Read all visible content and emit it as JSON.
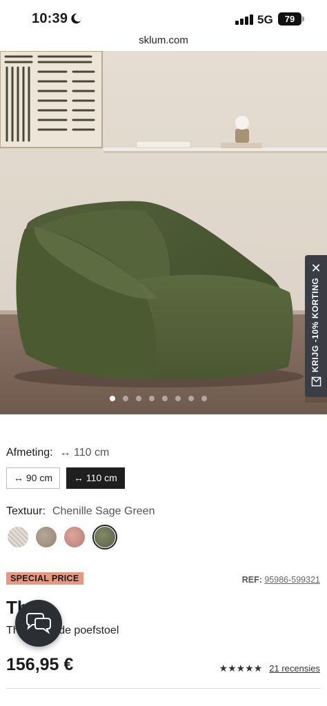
{
  "status_bar": {
    "time": "10:39",
    "network": "5G",
    "battery": "79"
  },
  "browser": {
    "url": "sklum.com"
  },
  "gallery": {
    "image_count": 8,
    "active_index": 0
  },
  "discount_tab": {
    "label": "KRIJG -10% KORTING",
    "close_icon": "close-icon",
    "icon": "mail-icon"
  },
  "size": {
    "label": "Afmeting:",
    "selected": "↔ 110 cm",
    "options": [
      "↔ 90 cm",
      "↔ 110 cm"
    ]
  },
  "texture": {
    "label": "Textuur:",
    "selected": "Chenille Sage Green",
    "options": [
      {
        "color": "#d9d2ca"
      },
      {
        "color": "#a59686"
      },
      {
        "color": "#c98f85"
      },
      {
        "color": "#6b7356"
      }
    ]
  },
  "product": {
    "badge": "SPECIAL PRICE",
    "ref_label": "REF:",
    "ref_value": "95986-599321",
    "name": "Th    o",
    "description": "Th        stoffeerde poefstoel",
    "price": "156,95 €",
    "stars": "★★★★★",
    "reviews": "21 recensies"
  },
  "colors": {
    "accent_badge": "#e9977f",
    "dark": "#1f1f1f",
    "chair_green": "#4d5a32"
  }
}
